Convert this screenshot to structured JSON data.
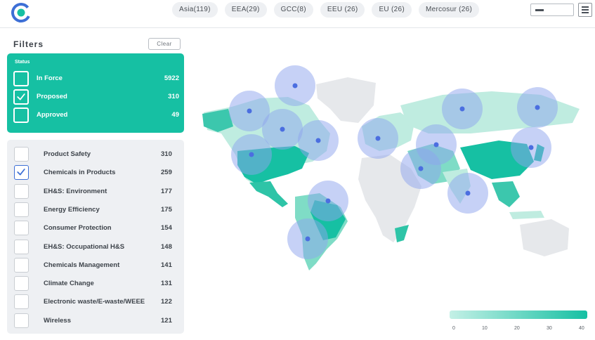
{
  "header": {
    "region_tabs": [
      {
        "label": "Asia(119)"
      },
      {
        "label": "EEA(29)"
      },
      {
        "label": "GCC(8)"
      },
      {
        "label": "EEU (26)"
      },
      {
        "label": "EU (26)"
      },
      {
        "label": "Mercosur (26)"
      }
    ]
  },
  "sidebar": {
    "title": "Filters",
    "clear_label": "Clear",
    "status": {
      "heading": "Status",
      "items": [
        {
          "label": "In Force",
          "count": "5922",
          "checked": false
        },
        {
          "label": "Proposed",
          "count": "310",
          "checked": true
        },
        {
          "label": "Approved",
          "count": "49",
          "checked": false
        }
      ]
    },
    "topics": [
      {
        "label": "Product Safety",
        "count": "310",
        "checked": false
      },
      {
        "label": "Chemicals in Products",
        "count": "259",
        "checked": true
      },
      {
        "label": "EH&S: Environment",
        "count": "177",
        "checked": false
      },
      {
        "label": "Energy Efficiency",
        "count": "175",
        "checked": false
      },
      {
        "label": "Consumer Protection",
        "count": "154",
        "checked": false
      },
      {
        "label": "EH&S: Occupational H&S",
        "count": "148",
        "checked": false
      },
      {
        "label": "Chemicals Management",
        "count": "141",
        "checked": false
      },
      {
        "label": "Climate Change",
        "count": "131",
        "checked": false
      },
      {
        "label": "Electronic waste/E-waste/WEEE",
        "count": "122",
        "checked": false
      },
      {
        "label": "Wireless",
        "count": "121",
        "checked": false
      }
    ]
  },
  "legend": {
    "ticks": [
      "0",
      "10",
      "20",
      "30",
      "40"
    ]
  },
  "colors": {
    "accent": "#16c0a3",
    "marker": "#4b6ee0",
    "marker_halo": "#8ea3ee",
    "check": "#3d6fd6",
    "logo": "#3d6fd6"
  },
  "icons": {
    "logo": "app-logo-icon",
    "menu": "hamburger-menu-icon",
    "check": "checkmark-icon"
  }
}
